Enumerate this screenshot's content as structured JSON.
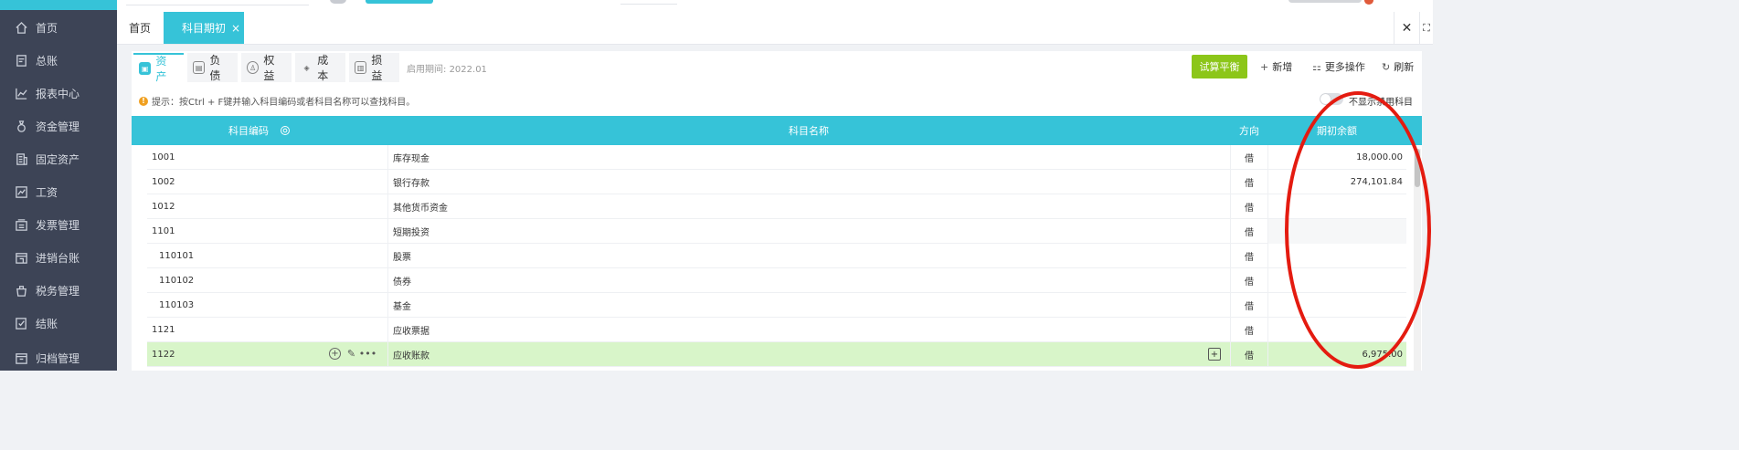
{
  "sidebar": {
    "items": [
      {
        "label": "首页",
        "icon": "home-icon"
      },
      {
        "label": "总账",
        "icon": "ledger-icon"
      },
      {
        "label": "报表中心",
        "icon": "report-chart-icon"
      },
      {
        "label": "资金管理",
        "icon": "money-bag-icon"
      },
      {
        "label": "固定资产",
        "icon": "building-icon"
      },
      {
        "label": "工资",
        "icon": "salary-icon"
      },
      {
        "label": "发票管理",
        "icon": "invoice-icon"
      },
      {
        "label": "进销台账",
        "icon": "store-icon"
      },
      {
        "label": "税务管理",
        "icon": "tax-icon"
      },
      {
        "label": "结账",
        "icon": "checkout-icon"
      },
      {
        "label": "归档管理",
        "icon": "archive-icon"
      }
    ]
  },
  "tabs": {
    "home": "首页",
    "active": "科目期初",
    "close": "×",
    "window_close": "✕"
  },
  "subtabs": [
    {
      "label": "资产",
      "icon": "asset-icon",
      "active": true
    },
    {
      "label": "负债",
      "icon": "liability-icon",
      "active": false
    },
    {
      "label": "权益",
      "icon": "equity-icon",
      "active": false
    },
    {
      "label": "成本",
      "icon": "cost-icon",
      "active": false
    },
    {
      "label": "损益",
      "icon": "profit-loss-icon",
      "active": false
    }
  ],
  "period": {
    "label": "启用期间:",
    "value": "2022.01"
  },
  "toolbar": {
    "trial_balance": "试算平衡",
    "add": "新增",
    "more": "更多操作",
    "refresh": "刷新"
  },
  "hint": "提示：按Ctrl + F键并输入科目编码或者科目名称可以查找科目。",
  "toggle_label": "不显示禁用科目",
  "table": {
    "headers": {
      "code": "科目编码",
      "name": "科目名称",
      "direction": "方向",
      "opening_balance": "期初余额"
    },
    "rows": [
      {
        "code": "1001",
        "name": "库存现金",
        "direction": "借",
        "amount": "18,000.00"
      },
      {
        "code": "1002",
        "name": "银行存款",
        "direction": "借",
        "amount": "274,101.84"
      },
      {
        "code": "1012",
        "name": "其他货币资金",
        "direction": "借",
        "amount": ""
      },
      {
        "code": "1101",
        "name": "短期投资",
        "direction": "借",
        "amount": ""
      },
      {
        "code": "110101",
        "name": "股票",
        "direction": "借",
        "amount": ""
      },
      {
        "code": "110102",
        "name": "债券",
        "direction": "借",
        "amount": ""
      },
      {
        "code": "110103",
        "name": "基金",
        "direction": "借",
        "amount": ""
      },
      {
        "code": "1121",
        "name": "应收票据",
        "direction": "借",
        "amount": ""
      },
      {
        "code": "1122",
        "name": "应收账款",
        "direction": "借",
        "amount": "6,975.00"
      }
    ]
  },
  "colors": {
    "accent": "#36c3d8",
    "sidebar": "#3d4456",
    "success": "#8cc619",
    "highlight_row": "#d8f5c9",
    "annotation": "#e41b10"
  }
}
